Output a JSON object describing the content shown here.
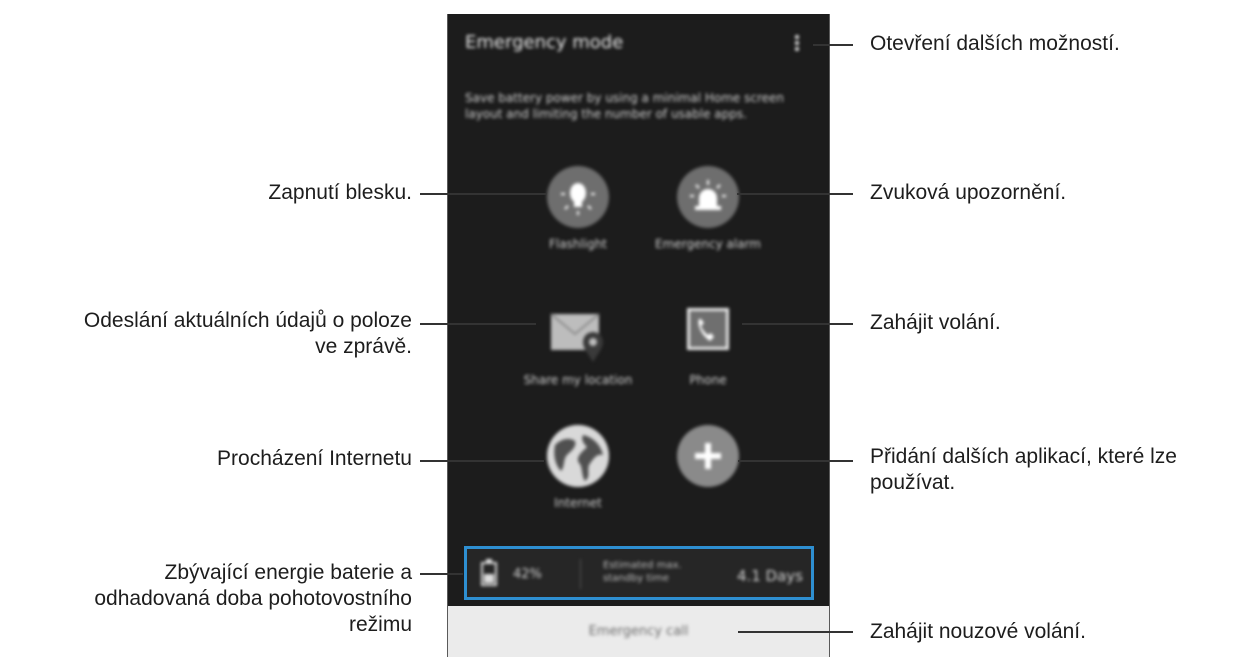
{
  "screen": {
    "title": "Emergency mode",
    "description": "Save battery power by using a minimal Home screen layout and limiting the number of usable apps.",
    "apps": {
      "flashlight": "Flashlight",
      "alarm": "Emergency alarm",
      "share_location": "Share my location",
      "phone": "Phone",
      "internet": "Internet"
    },
    "battery": {
      "percent": "42%",
      "standby_label": "Estimated max. standby time",
      "standby_value": "4.1 Days"
    },
    "emergency_call": "Emergency call"
  },
  "callouts": {
    "more_options": "Otevření dalších možností.",
    "flashlight": "Zapnutí blesku.",
    "alarm": "Zvuková upozornění.",
    "share_location_1": "Odeslání aktuálních údajů o poloze",
    "share_location_2": "ve zprávě.",
    "phone": "Zahájit volání.",
    "internet": "Procházení Internetu",
    "add_apps_1": "Přidání dalších aplikací, které lze",
    "add_apps_2": "používat.",
    "battery_1": "Zbývající energie baterie a",
    "battery_2": "odhadovaná doba pohotovostního",
    "battery_3": "režimu",
    "emergency_call": "Zahájit nouzové volání."
  },
  "colors": {
    "screen_bg": "#1c1c1c",
    "highlight": "#2e8fd1",
    "icon_circle": "#6e6e6e"
  }
}
